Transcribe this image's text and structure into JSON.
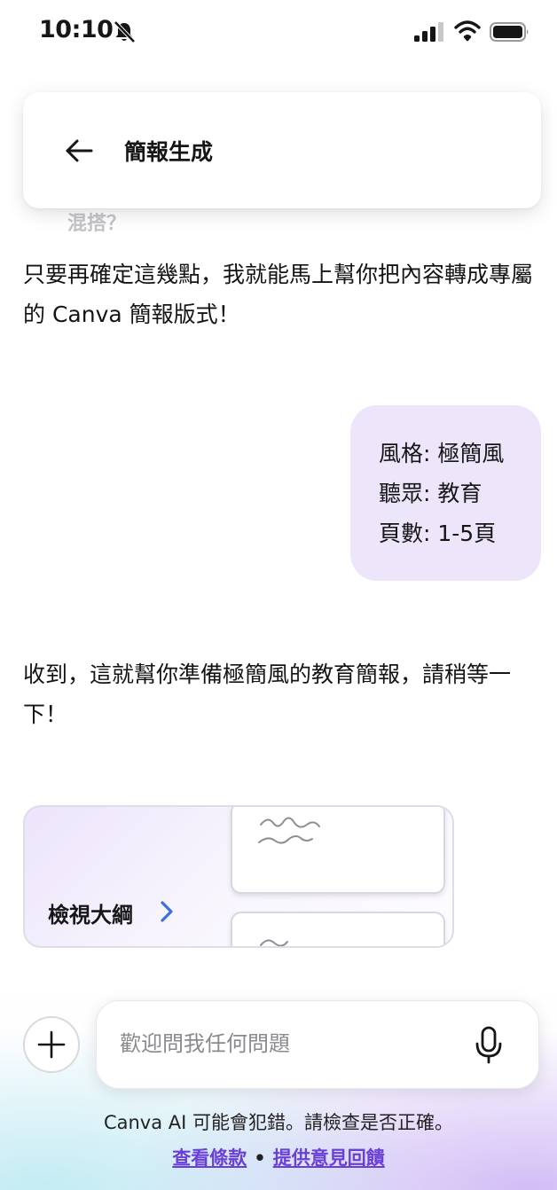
{
  "status_bar": {
    "time": "10:10",
    "icons": [
      "bell-off-icon",
      "signal-icon",
      "wifi-icon",
      "battery-icon"
    ]
  },
  "header": {
    "back_icon": "arrow-left-icon",
    "title": "簡報生成"
  },
  "chat": {
    "faded_prev_text": "混搭？",
    "ai_message_1": "只要再確定這幾點，我就能馬上幫你把內容轉成專屬的 Canva 簡報版式！",
    "user_message": {
      "lines": [
        "風格: 極簡風",
        "聽眾: 教育",
        "頁數: 1-5頁"
      ]
    },
    "ai_message_2": "收到，這就幫你準備極簡風的教育簡報，請稍等一下！",
    "outline_card": {
      "label": "檢視大綱",
      "chevron_icon": "chevron-right-icon"
    }
  },
  "composer": {
    "plus_icon": "plus-icon",
    "placeholder": "歡迎問我任何問題",
    "mic_icon": "microphone-icon"
  },
  "footer": {
    "disclaimer": "Canva AI 可能會犯錯。請檢查是否正確。",
    "terms_link": "查看條款",
    "separator": "•",
    "feedback_link": "提供意見回饋"
  },
  "colors": {
    "user_bubble": "#ede6fb",
    "link": "#6a3fd6",
    "chevron": "#3b6fe0"
  }
}
